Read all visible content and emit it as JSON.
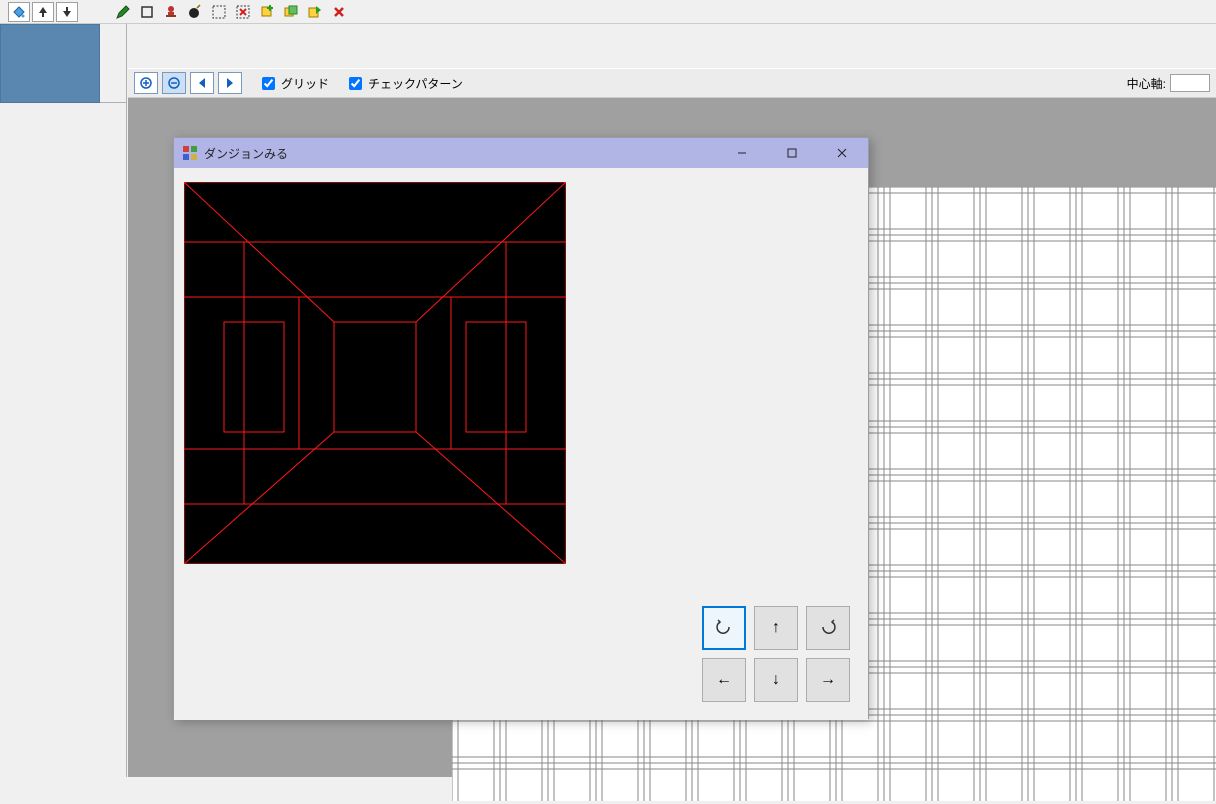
{
  "toolbar1": {
    "paint_bucket": "paint-bucket",
    "arrow_up": "up",
    "arrow_down": "down",
    "pencil": "pencil",
    "rect": "rectangle",
    "stamp": "stamp",
    "bomb": "bomb",
    "marquee": "marquee",
    "marquee_x": "marquee-delete",
    "layer_add": "layer-add",
    "layer_copy": "layer-copy",
    "layer_export": "layer-export",
    "delete": "delete"
  },
  "toolbar2": {
    "zoom_in": "zoom-in",
    "zoom_out": "zoom-out",
    "arrow_left": "left",
    "arrow_right": "right",
    "grid_label": "グリッド",
    "grid_checked": true,
    "check_pattern_label": "チェックパターン",
    "check_pattern_checked": true,
    "center_axis_label": "中心軸:",
    "center_axis_value": ""
  },
  "dialog": {
    "title": "ダンジョンみる",
    "buttons": {
      "turn_left": "↶",
      "forward": "↑",
      "turn_right": "↷",
      "strafe_left": "←",
      "back": "↓",
      "strafe_right": "→"
    }
  }
}
